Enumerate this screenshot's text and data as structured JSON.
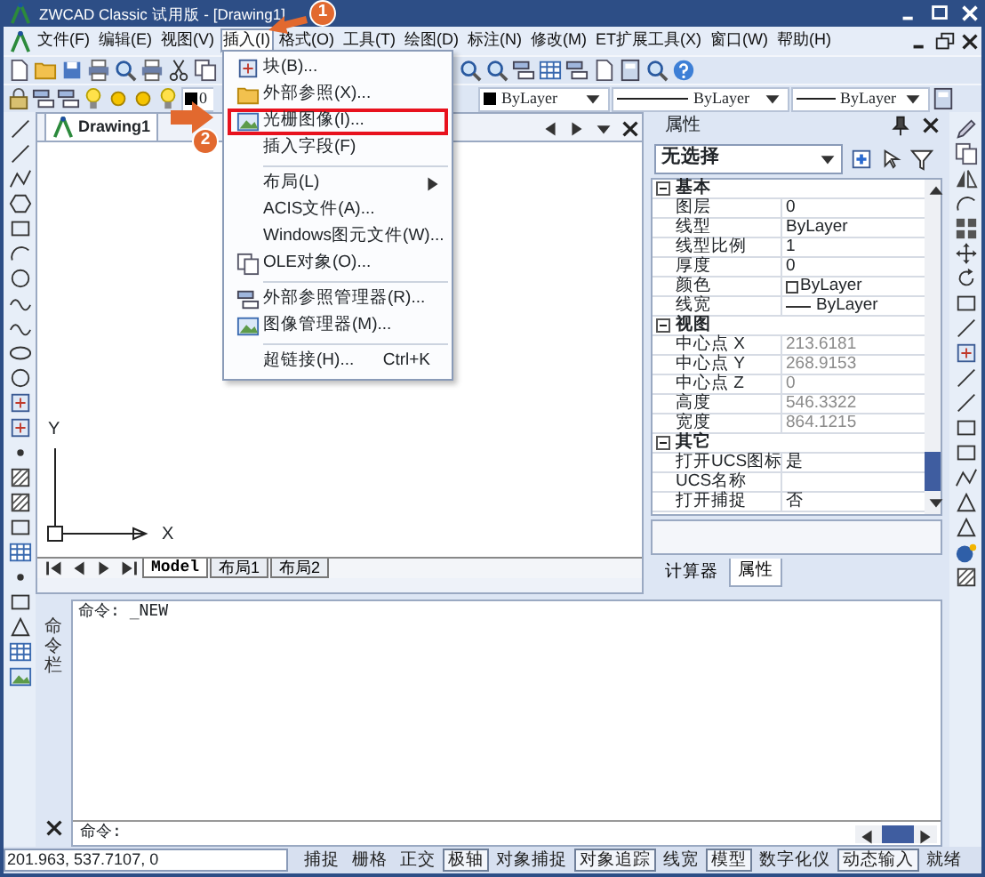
{
  "window": {
    "title": "ZWCAD Classic 试用版 - [Drawing1]"
  },
  "menu_bar": [
    {
      "label": "文件(F)",
      "selected": false
    },
    {
      "label": "编辑(E)",
      "selected": false
    },
    {
      "label": "视图(V)",
      "selected": false
    },
    {
      "label": "插入(I)",
      "selected": true
    },
    {
      "label": "格式(O)",
      "selected": false
    },
    {
      "label": "工具(T)",
      "selected": false
    },
    {
      "label": "绘图(D)",
      "selected": false
    },
    {
      "label": "标注(N)",
      "selected": false
    },
    {
      "label": "修改(M)",
      "selected": false
    },
    {
      "label": "ET扩展工具(X)",
      "selected": false
    },
    {
      "label": "窗口(W)",
      "selected": false
    },
    {
      "label": "帮助(H)",
      "selected": false
    }
  ],
  "insert_menu": [
    {
      "kind": "item",
      "label": "块(B)...",
      "highlighted": false
    },
    {
      "kind": "item",
      "label": "外部参照(X)...",
      "highlighted": false
    },
    {
      "kind": "item",
      "label": "光栅图像(I)...",
      "highlighted": true
    },
    {
      "kind": "item",
      "label": "插入字段(F)",
      "highlighted": false
    },
    {
      "kind": "separator"
    },
    {
      "kind": "submenu",
      "label": "布局(L)",
      "highlighted": false
    },
    {
      "kind": "item",
      "label": "ACIS文件(A)...",
      "highlighted": false
    },
    {
      "kind": "item",
      "label": "Windows图元文件(W)...",
      "highlighted": false
    },
    {
      "kind": "item",
      "label": "OLE对象(O)...",
      "highlighted": false
    },
    {
      "kind": "separator"
    },
    {
      "kind": "item",
      "label": "外部参照管理器(R)...",
      "highlighted": false
    },
    {
      "kind": "item",
      "label": "图像管理器(M)...",
      "highlighted": false
    },
    {
      "kind": "separator"
    },
    {
      "kind": "item",
      "label": "超链接(H)...",
      "shortcut": "Ctrl+K",
      "highlighted": false
    }
  ],
  "callouts": [
    {
      "number": "1"
    },
    {
      "number": "2"
    }
  ],
  "layer_toolbar": {
    "layer": "0",
    "color_setting": "ByLayer",
    "linetype": "ByLayer",
    "lineweight": "ByLayer"
  },
  "document": {
    "tab": "Drawing1",
    "ucs": {
      "y_label": "Y",
      "x_label": "X"
    },
    "layout_tabs": [
      {
        "label": "Model",
        "selected": true
      },
      {
        "label": "布局1",
        "selected": false
      },
      {
        "label": "布局2",
        "selected": false
      }
    ]
  },
  "properties": {
    "title": "属性",
    "selection": "无选择",
    "sections": [
      {
        "title": "基本",
        "expanded": true,
        "rows": [
          {
            "name": "图层",
            "value": "0",
            "kind": "text",
            "readonly": false
          },
          {
            "name": "线型",
            "value": "ByLayer",
            "kind": "text",
            "readonly": false
          },
          {
            "name": "线型比例",
            "value": "1",
            "kind": "text",
            "readonly": false
          },
          {
            "name": "厚度",
            "value": "0",
            "kind": "text",
            "readonly": false
          },
          {
            "name": "颜色",
            "value": "ByLayer",
            "kind": "color",
            "readonly": false
          },
          {
            "name": "线宽",
            "value": "ByLayer",
            "kind": "lineweight",
            "readonly": false
          }
        ]
      },
      {
        "title": "视图",
        "expanded": true,
        "rows": [
          {
            "name": "中心点 X",
            "value": "213.6181",
            "kind": "text",
            "readonly": true
          },
          {
            "name": "中心点 Y",
            "value": "268.9153",
            "kind": "text",
            "readonly": true
          },
          {
            "name": "中心点 Z",
            "value": "0",
            "kind": "text",
            "readonly": true
          },
          {
            "name": "高度",
            "value": "546.3322",
            "kind": "text",
            "readonly": true
          },
          {
            "name": "宽度",
            "value": "864.1215",
            "kind": "text",
            "readonly": true
          }
        ]
      },
      {
        "title": "其它",
        "expanded": true,
        "rows": [
          {
            "name": "打开UCS图标",
            "value": "是",
            "kind": "text",
            "readonly": false
          },
          {
            "name": "UCS名称",
            "kind": "text",
            "readonly": false
          },
          {
            "name": "打开捕捉",
            "value": "否",
            "kind": "text",
            "readonly": false
          }
        ]
      }
    ],
    "tabs": [
      {
        "label": "计算器",
        "selected": false
      },
      {
        "label": "属性",
        "selected": true
      }
    ]
  },
  "command_window": {
    "label": "命令栏",
    "history": [
      "命令: _NEW"
    ],
    "prompt": "命令:"
  },
  "status_bar": {
    "coordinates": "201.963, 537.7107, 0",
    "toggles": [
      {
        "label": "捕捉",
        "on": false
      },
      {
        "label": "栅格",
        "on": false
      },
      {
        "label": "正交",
        "on": false
      },
      {
        "label": "极轴",
        "on": true
      },
      {
        "label": "对象捕捉",
        "on": false
      },
      {
        "label": "对象追踪",
        "on": true
      },
      {
        "label": "线宽",
        "on": false
      },
      {
        "label": "模型",
        "on": true
      },
      {
        "label": "数字化仪",
        "on": false
      },
      {
        "label": "动态输入",
        "on": true
      }
    ],
    "status": "就绪"
  }
}
